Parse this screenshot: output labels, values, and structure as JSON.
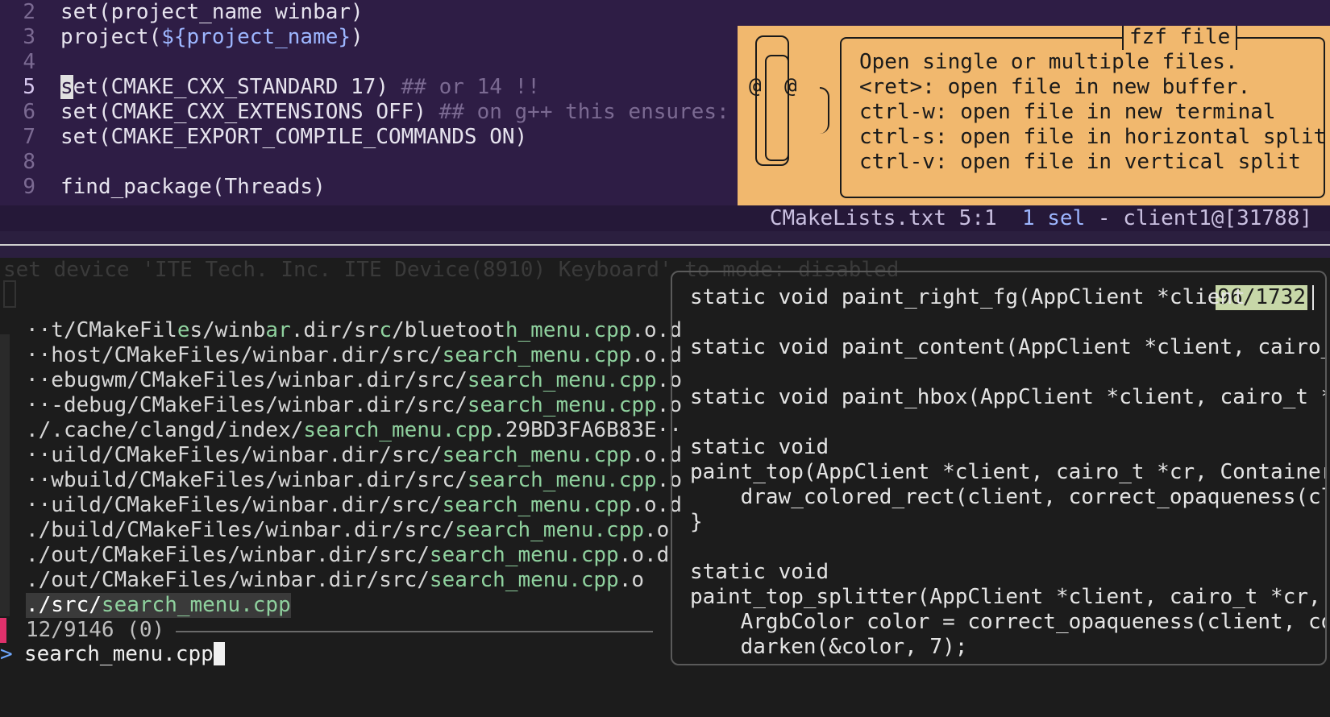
{
  "editor": {
    "lines": [
      {
        "num": "2",
        "text": "set(project_name winbar)"
      },
      {
        "num": "3",
        "pre": "project(",
        "var": "${project_name}",
        "post": ")"
      },
      {
        "num": "4",
        "text": ""
      },
      {
        "num": "5",
        "cursor_char": "s",
        "text": "et(CMAKE_CXX_STANDARD 17) ",
        "comment": "## or 14 !!"
      },
      {
        "num": "6",
        "text": "set(CMAKE_CXX_EXTENSIONS OFF) ",
        "comment": "## on g++ this ensures: -s"
      },
      {
        "num": "7",
        "text": "set(CMAKE_EXPORT_COMPILE_COMMANDS ON)"
      },
      {
        "num": "8",
        "text": ""
      },
      {
        "num": "9",
        "text": "find_package(Threads)"
      }
    ]
  },
  "fzf_info": {
    "title": "fzf file",
    "clip_left": "@",
    "clip_right": "@",
    "lines": [
      "Open single or multiple files.",
      "<ret>: open file in new buffer.",
      "ctrl-w: open file in new terminal",
      "ctrl-s: open file in horizontal split",
      "ctrl-v: open file in vertical split"
    ]
  },
  "status": {
    "file": "CMakeLists.txt 5:1",
    "sel": "1 sel",
    "client": " - client1@[31788]"
  },
  "terminal": {
    "ghost_text": "set device 'ITE Tech. Inc. ITE Device(8910) Keyboard' to mode: disabled",
    "results": [
      {
        "pre": "··t/CMakeFil",
        "m1": "e",
        "mid1": "s/winb",
        "m2": "ar",
        "mid2": ".dir/sr",
        "m3": "c",
        "mid3": "/bluetoot",
        "m4": "h_menu.cpp",
        "post": ".o.d"
      },
      {
        "pre": "··host/CMakeFiles/winbar.dir/src/",
        "match": "search_menu.cpp",
        "post": ".o.d"
      },
      {
        "pre": "··ebugwm/CMakeFiles/winbar.dir/src/",
        "match": "search_menu.cpp",
        "post": ".o"
      },
      {
        "pre": "··-debug/CMakeFiles/winbar.dir/src/",
        "match": "search_menu.cpp",
        "post": ".o"
      },
      {
        "pre": "./.cache/clangd/index/",
        "match": "search_menu.cpp",
        "post": ".29BD3FA6B83E··"
      },
      {
        "pre": "··uild/CMakeFiles/winbar.dir/src/",
        "match": "search_menu.cpp",
        "post": ".o.d"
      },
      {
        "pre": "··wbuild/CMakeFiles/winbar.dir/src/",
        "match": "search_menu.cpp",
        "post": ".o"
      },
      {
        "pre": "··uild/CMakeFiles/winbar.dir/src/",
        "match": "search_menu.cpp",
        "post": ".o.d"
      },
      {
        "pre": "./build/CMakeFiles/winbar.dir/src/",
        "match": "search_menu.cpp",
        "post": ".o"
      },
      {
        "pre": "./out/CMakeFiles/winbar.dir/src/",
        "match": "search_menu.cpp",
        "post": ".o.d"
      },
      {
        "pre": "./out/CMakeFiles/winbar.dir/src/",
        "match": "search_menu.cpp",
        "post": ".o"
      },
      {
        "pre": "./src/",
        "match": "search_menu.cpp",
        "post": ""
      }
    ],
    "counter": "12/9146 (0)",
    "prompt": ">",
    "query": "search_menu.cpp"
  },
  "preview": {
    "scroll_indicator": "96/1732",
    "lines": [
      "static void paint_right_fg(AppClient *client",
      "",
      "static void paint_content(AppClient *client, cairo_",
      "",
      "static void paint_hbox(AppClient *client, cairo_t *",
      "",
      "static void",
      "paint_top(AppClient *client, cairo_t *cr, Container",
      "    draw_colored_rect(client, correct_opaqueness(cl",
      "}",
      "",
      "static void",
      "paint_top_splitter(AppClient *client, cairo_t *cr,",
      "    ArgbColor color = correct_opaqueness(client, co",
      "    darken(&color, 7);"
    ]
  }
}
